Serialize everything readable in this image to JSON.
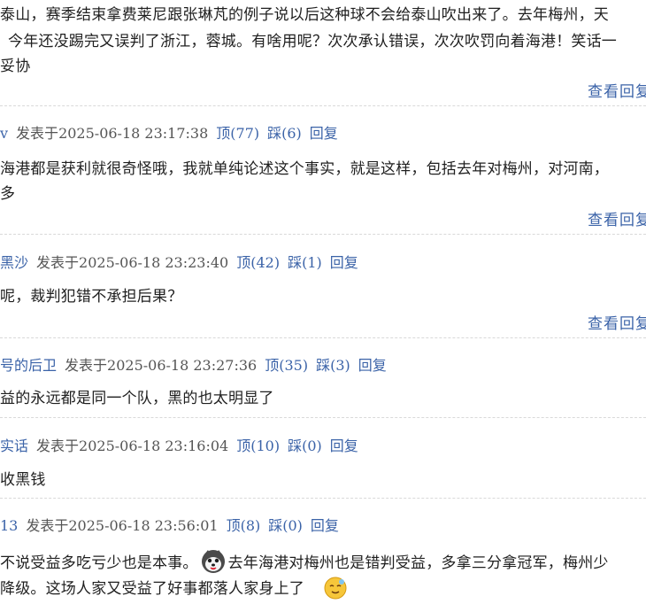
{
  "ui": {
    "view_replies": "查看回复",
    "posted_at": "发表于",
    "reply": "回复"
  },
  "top_comment": {
    "lines": [
      "泰山，赛季结束拿费莱尼跟张琳芃的例子说以后这种球不会给泰山吹出来了。去年梅州，天",
      "今年还没踢完又误判了浙江，蓉城。有啥用呢？次次承认错误，次次吹罚向着海港！笑话一",
      "妥协"
    ]
  },
  "comments": [
    {
      "user": "v",
      "time": "2025-06-18 23:17:38",
      "up": "顶(77)",
      "down": "踩(6)",
      "lines": [
        "海港都是获利就很奇怪哦，我就单纯论述这个事实，就是这样，包括去年对梅州，对河南，",
        "多"
      ]
    },
    {
      "user": "黑沙",
      "time": "2025-06-18 23:23:40",
      "up": "顶(42)",
      "down": "踩(1)",
      "lines": [
        "呢，裁判犯错不承担后果？"
      ]
    },
    {
      "user": "号的后卫",
      "time": "2025-06-18 23:27:36",
      "up": "顶(35)",
      "down": "踩(3)",
      "lines": [
        "益的永远都是同一个队，黑的也太明显了"
      ]
    },
    {
      "user": "实话",
      "time": "2025-06-18 23:16:04",
      "up": "顶(10)",
      "down": "踩(0)",
      "lines": [
        "收黑钱"
      ]
    },
    {
      "user": "13",
      "time": "2025-06-18 23:56:01",
      "up": "顶(8)",
      "down": "踩(0)",
      "lines": [
        "不说受益多吃亏少也是本事。",
        "去年海港对梅州也是错判受益，多拿三分拿冠军，梅州少",
        "降级。这场人家又受益了好事都落人家身上了"
      ]
    }
  ],
  "icons": {
    "emoji_1": "husky-face-icon",
    "emoji_2": "blush-face-icon"
  }
}
